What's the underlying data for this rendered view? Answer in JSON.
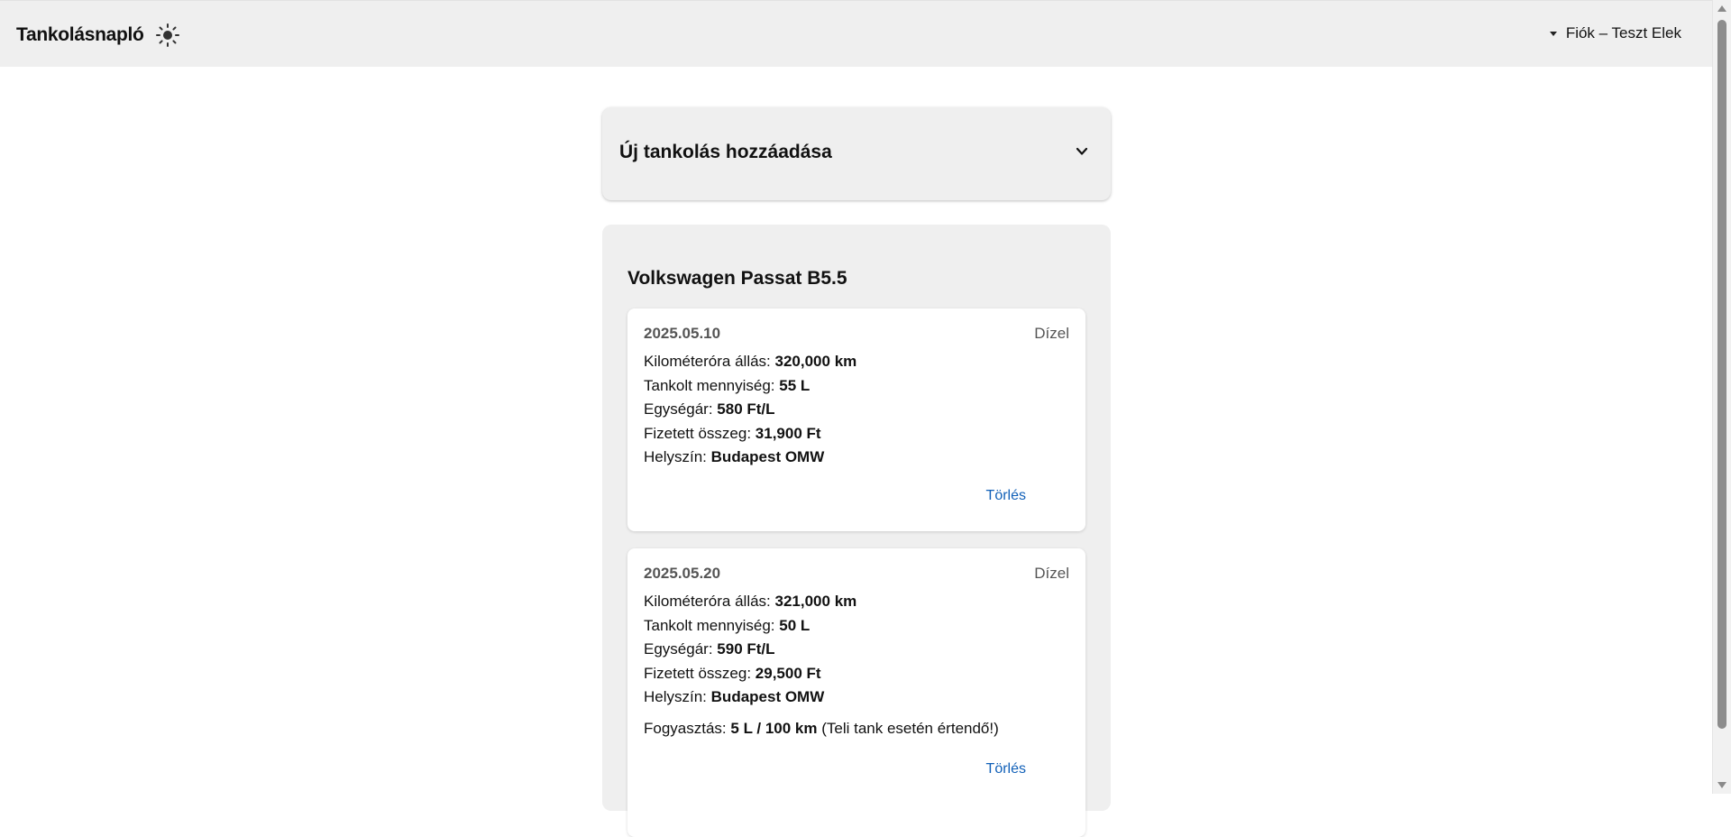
{
  "header": {
    "title": "Tankolásnapló",
    "theme_icon": "sun-icon",
    "account_label": "Fiók – Teszt Elek"
  },
  "add_panel": {
    "title": "Új tankolás hozzáadása"
  },
  "car": {
    "name": "Volkswagen Passat B5.5",
    "entries": [
      {
        "date": "2025.05.10",
        "fuel": "Dízel",
        "odometer_label": "Kilométeróra állás:",
        "odometer": "320,000 km",
        "amount_label": "Tankolt mennyiség:",
        "amount": "55 L",
        "unit_price_label": "Egységár:",
        "unit_price": "580 Ft/L",
        "total_label": "Fizetett összeg:",
        "total": "31,900 Ft",
        "location_label": "Helyszín:",
        "location": "Budapest OMW",
        "delete_label": "Törlés"
      },
      {
        "date": "2025.05.20",
        "fuel": "Dízel",
        "odometer_label": "Kilométeróra állás:",
        "odometer": "321,000 km",
        "amount_label": "Tankolt mennyiség:",
        "amount": "50 L",
        "unit_price_label": "Egységár:",
        "unit_price": "590 Ft/L",
        "total_label": "Fizetett összeg:",
        "total": "29,500 Ft",
        "location_label": "Helyszín:",
        "location": "Budapest OMW",
        "consumption_label": "Fogyasztás:",
        "consumption": "5 L / 100 km",
        "consumption_note": "(Teli tank esetén értendő!)",
        "delete_label": "Törlés"
      }
    ]
  },
  "colors": {
    "topbar_bg": "#efefef",
    "panel_bg": "#efefef",
    "card_bg": "#ffffff",
    "link": "#1160b8"
  }
}
